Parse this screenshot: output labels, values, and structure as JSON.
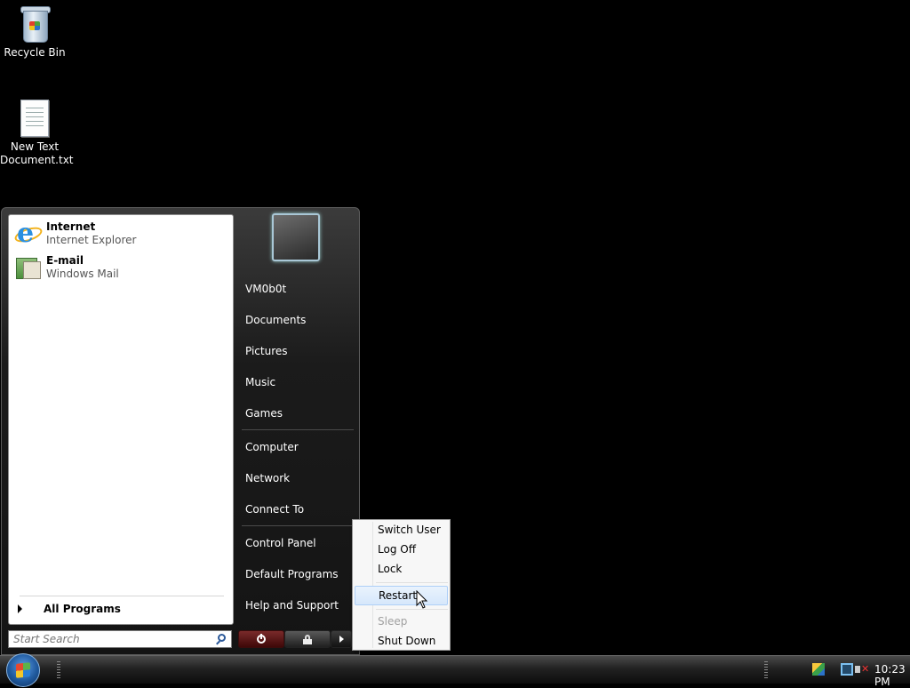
{
  "desktop": {
    "icons": [
      {
        "label": "Recycle Bin",
        "icon": "recycle-bin-icon"
      },
      {
        "label_line1": "New Text",
        "label_line2": "Document.txt",
        "icon": "text-document-icon"
      }
    ]
  },
  "start_menu": {
    "pinned": [
      {
        "title": "Internet",
        "subtitle": "Internet Explorer",
        "icon": "internet-explorer-icon"
      },
      {
        "title": "E-mail",
        "subtitle": "Windows Mail",
        "icon": "windows-mail-icon"
      }
    ],
    "all_programs": "All Programs",
    "search_placeholder": "Start Search",
    "right_links": {
      "user": "VM0b0t",
      "documents": "Documents",
      "pictures": "Pictures",
      "music": "Music",
      "games": "Games",
      "computer": "Computer",
      "network": "Network",
      "connect_to": "Connect To",
      "control_panel": "Control Panel",
      "default_programs": "Default Programs",
      "help_support": "Help and Support"
    }
  },
  "power_menu": {
    "items": [
      {
        "label": "Switch User",
        "enabled": true
      },
      {
        "label": "Log Off",
        "enabled": true
      },
      {
        "label": "Lock",
        "enabled": true
      },
      {
        "label": "Restart",
        "enabled": true,
        "highlighted": true
      },
      {
        "label": "Sleep",
        "enabled": false
      },
      {
        "label": "Shut Down",
        "enabled": true
      }
    ]
  },
  "taskbar": {
    "clock": "10:23 PM"
  }
}
